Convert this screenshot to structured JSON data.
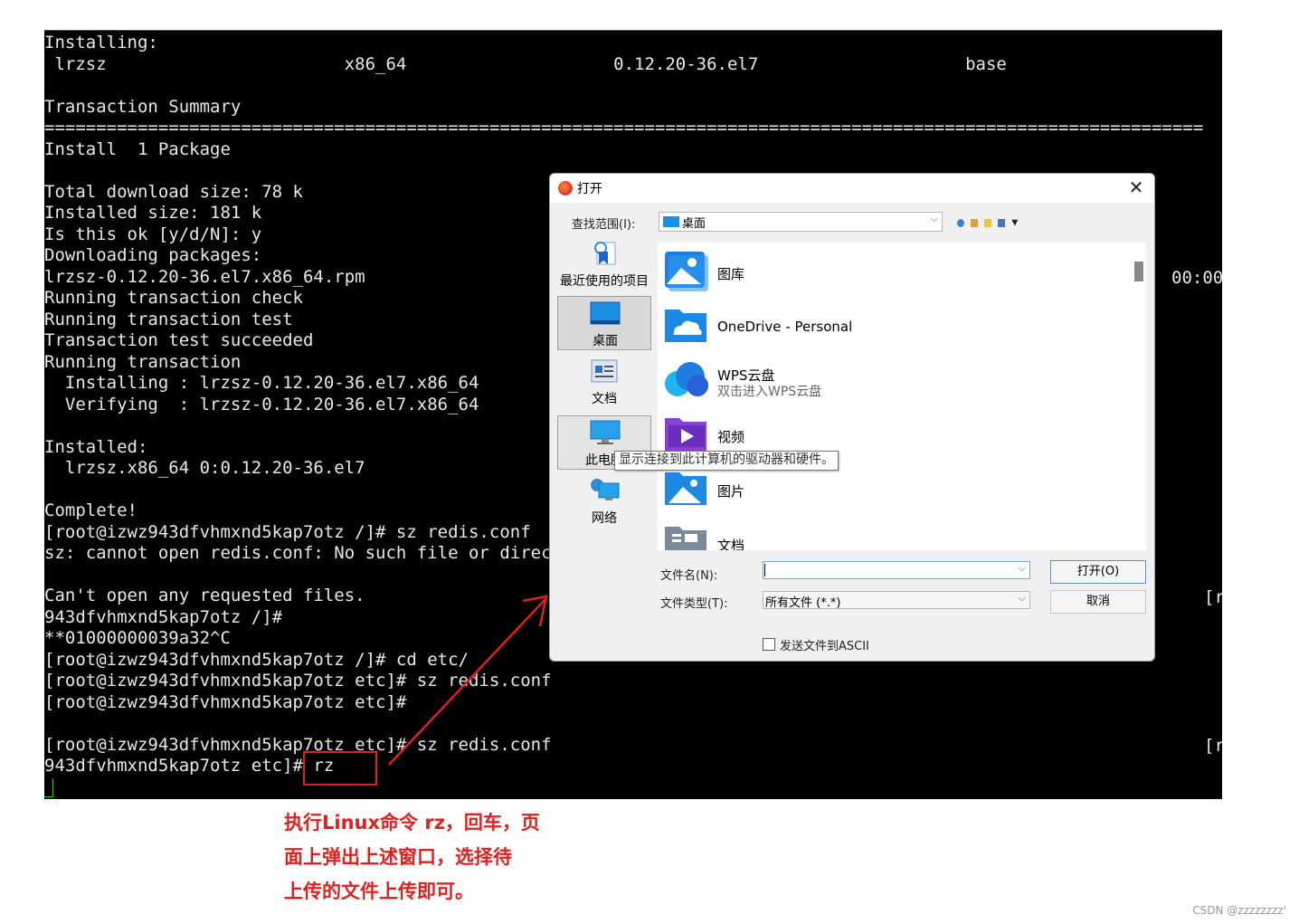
{
  "terminal": {
    "lines": [
      "Installing:",
      " lrzsz                       x86_64                    0.12.20-36.el7                    base",
      "",
      "Transaction Summary",
      "================================================================================================================",
      "Install  1 Package",
      "",
      "Total download size: 78 k",
      "Installed size: 181 k",
      "Is this ok [y/d/N]: y",
      "Downloading packages:",
      "lrzsz-0.12.20-36.el7.x86_64.rpm",
      "Running transaction check",
      "Running transaction test",
      "Transaction test succeeded",
      "Running transaction",
      "  Installing : lrzsz-0.12.20-36.el7.x86_64",
      "  Verifying  : lrzsz-0.12.20-36.el7.x86_64",
      "",
      "Installed:",
      "  lrzsz.x86_64 0:0.12.20-36.el7",
      "",
      "Complete!",
      "[root@izwz943dfvhmxnd5kap7otz /]# sz redis.conf",
      "sz: cannot open redis.conf: No such file or direc",
      "",
      "Can't open any requested files.",
      "943dfvhmxnd5kap7otz /]#",
      "**01000000039a32^C",
      "[root@izwz943dfvhmxnd5kap7otz /]# cd etc/",
      "[root@izwz943dfvhmxnd5kap7otz etc]# sz redis.conf",
      "[root@izwz943dfvhmxnd5kap7otz etc]#",
      "",
      "[root@izwz943dfvhmxnd5kap7otz etc]# sz redis.conf",
      "943dfvhmxnd5kap7otz etc]# rz"
    ],
    "right_time": "00:00",
    "right_bracket_1": "[r",
    "right_bracket_2": "[r"
  },
  "dialog": {
    "title": "打开",
    "look_in_label": "查找范围(I):",
    "look_in_value": "桌面",
    "places": [
      {
        "label": "最近使用的项目"
      },
      {
        "label": "桌面"
      },
      {
        "label": "文档"
      },
      {
        "label": "此电脑"
      },
      {
        "label": "网络"
      }
    ],
    "files": [
      {
        "name": "图库",
        "sub": ""
      },
      {
        "name": "OneDrive - Personal",
        "sub": ""
      },
      {
        "name": "WPS云盘",
        "sub": "双击进入WPS云盘"
      },
      {
        "name": "视频",
        "sub": ""
      },
      {
        "name": "图片",
        "sub": ""
      },
      {
        "name": "文档",
        "sub": ""
      }
    ],
    "tooltip": "显示连接到此计算机的驱动器和硬件。",
    "file_name_label": "文件名(N):",
    "file_name_value": "",
    "file_type_label": "文件类型(T):",
    "file_type_value": "所有文件 (*.*)",
    "open_button": "打开(O)",
    "cancel_button": "取消",
    "ascii_checkbox_label": "发送文件到ASCII",
    "ascii_checked": false
  },
  "annotation": {
    "lines": [
      "执行Linux命令 rz，回车，页",
      "面上弹出上述窗口，选择待",
      "上传的文件上传即可。"
    ],
    "color": "#e02020"
  },
  "watermark": "CSDN @zzzzzzzz'"
}
